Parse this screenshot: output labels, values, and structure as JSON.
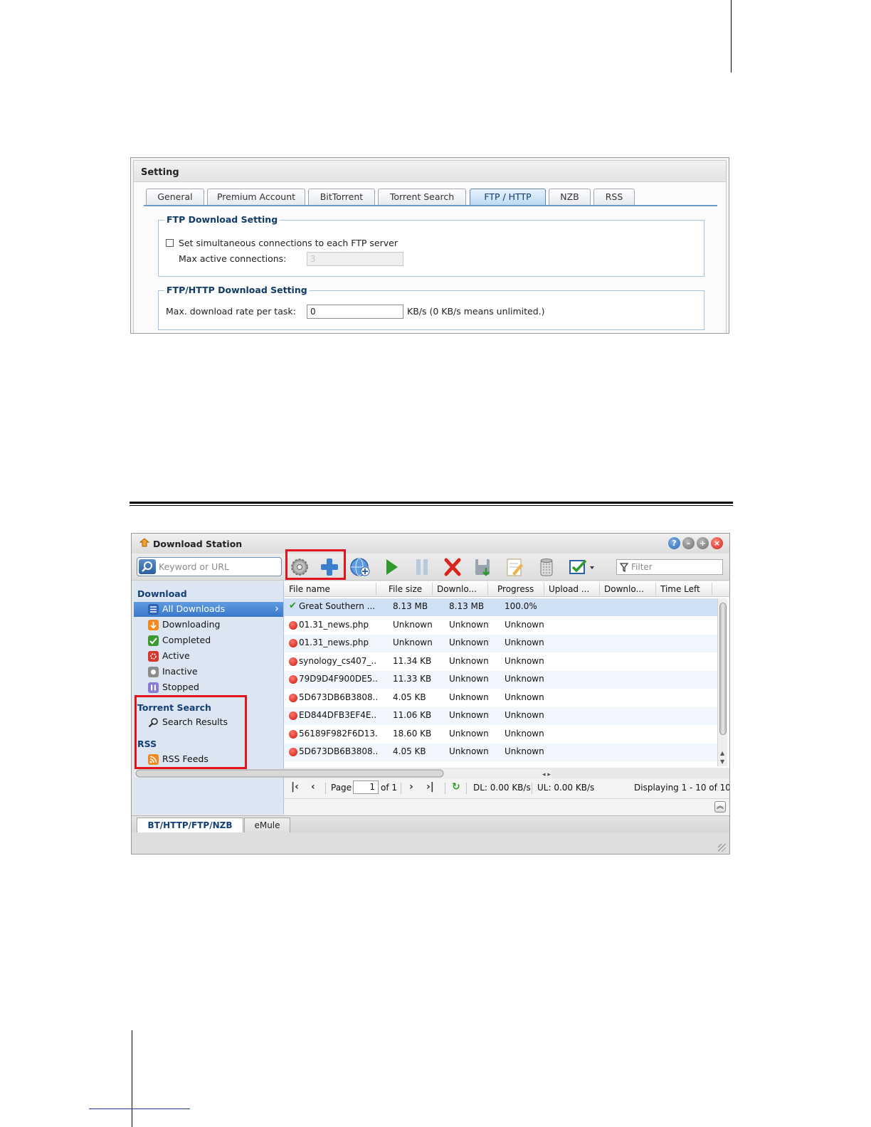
{
  "setting_panel": {
    "title": "Setting",
    "tabs": [
      {
        "label": "General"
      },
      {
        "label": "Premium Account"
      },
      {
        "label": "BitTorrent"
      },
      {
        "label": "Torrent Search"
      },
      {
        "label": "FTP / HTTP",
        "active": true
      },
      {
        "label": "NZB"
      },
      {
        "label": "RSS"
      }
    ],
    "ftp_download": {
      "legend": "FTP Download Setting",
      "checkbox_label": "Set simultaneous connections to each FTP server",
      "checked": false,
      "max_label": "Max active connections:",
      "max_value": "3"
    },
    "ftp_http_download": {
      "legend": "FTP/HTTP Download Setting",
      "rate_label": "Max. download rate per task:",
      "rate_value": "0",
      "rate_unit": "KB/s (0 KB/s means unlimited.)"
    }
  },
  "download_station": {
    "title": "Download Station",
    "search": {
      "placeholder": "Keyword or URL"
    },
    "filter": {
      "placeholder": "Filter"
    },
    "toolbar_icons": [
      "gear-icon",
      "add-icon",
      "globe-add-icon",
      "play-icon",
      "pause-icon",
      "delete-icon",
      "save-icon",
      "edit-icon",
      "trash-icon",
      "select-all-icon"
    ],
    "sidebar": {
      "download_heading": "Download",
      "download_items": [
        {
          "label": "All Downloads",
          "selected": true
        },
        {
          "label": "Downloading"
        },
        {
          "label": "Completed"
        },
        {
          "label": "Active"
        },
        {
          "label": "Inactive"
        },
        {
          "label": "Stopped"
        }
      ],
      "torrent_heading": "Torrent Search",
      "torrent_items": [
        {
          "label": "Search Results"
        }
      ],
      "rss_heading": "RSS",
      "rss_items": [
        {
          "label": "RSS Feeds"
        }
      ]
    },
    "grid": {
      "columns": [
        "File name",
        "File size",
        "Downlo...",
        "Progress",
        "Upload ...",
        "Downlo...",
        "Time Left"
      ],
      "rows": [
        {
          "status": "ok",
          "name": "Great Southern ...",
          "size": "8.13 MB",
          "downloaded": "8.13 MB",
          "progress": "100.0%"
        },
        {
          "status": "error",
          "name": "01.31_news.php",
          "size": "Unknown",
          "downloaded": "Unknown",
          "progress": "Unknown"
        },
        {
          "status": "error",
          "name": "01.31_news.php",
          "size": "Unknown",
          "downloaded": "Unknown",
          "progress": "Unknown"
        },
        {
          "status": "error",
          "name": "synology_cs407_...",
          "size": "11.34 KB",
          "downloaded": "Unknown",
          "progress": "Unknown"
        },
        {
          "status": "error",
          "name": "79D9D4F900DE5...",
          "size": "11.33 KB",
          "downloaded": "Unknown",
          "progress": "Unknown"
        },
        {
          "status": "error",
          "name": "5D673DB6B3808...",
          "size": "4.05 KB",
          "downloaded": "Unknown",
          "progress": "Unknown"
        },
        {
          "status": "error",
          "name": "ED844DFB3EF4E...",
          "size": "11.06 KB",
          "downloaded": "Unknown",
          "progress": "Unknown"
        },
        {
          "status": "error",
          "name": "56189F982F6D13...",
          "size": "18.60 KB",
          "downloaded": "Unknown",
          "progress": "Unknown"
        },
        {
          "status": "error",
          "name": "5D673DB6B3808...",
          "size": "4.05 KB",
          "downloaded": "Unknown",
          "progress": "Unknown"
        }
      ]
    },
    "pager": {
      "page_label": "Page",
      "page_value": "1",
      "of_label": "of 1",
      "dl": "DL: 0.00 KB/s",
      "ul": "UL: 0.00 KB/s",
      "displaying": "Displaying 1 - 10 of 10"
    },
    "bottom_tabs": [
      {
        "label": "BT/HTTP/FTP/NZB",
        "active": true
      },
      {
        "label": "eMule"
      }
    ]
  }
}
